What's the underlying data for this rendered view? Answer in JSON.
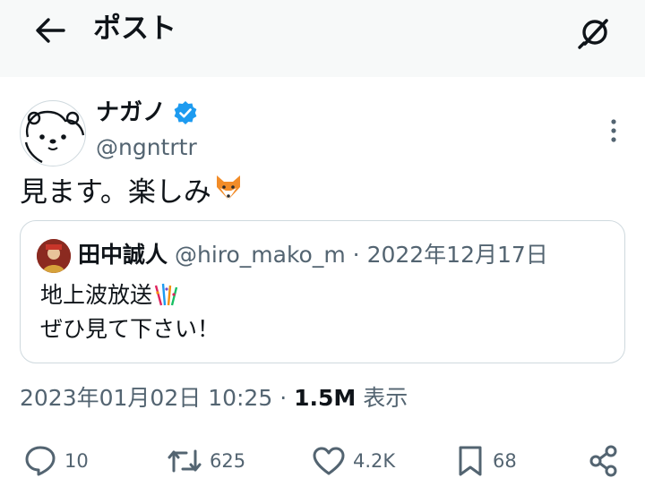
{
  "header": {
    "title": "ポスト",
    "back_icon": "arrow-left-icon",
    "grok_icon": "grok-icon"
  },
  "author": {
    "name": "ナガノ",
    "handle": "@ngntrtr",
    "verified": true,
    "verified_color": "#1d9bf0"
  },
  "tweet": {
    "text": "見ます。楽しみ",
    "emoji": "🦊"
  },
  "quote": {
    "name": "田中誠人",
    "handle": "@hiro_mako_m",
    "separator": "·",
    "date": "2022年12月17日",
    "line1": "地上波放送",
    "line1_emoji": "🎊",
    "line2": "ぜひ見て下さい！"
  },
  "meta": {
    "timestamp": "2023年01月02日 10:25",
    "separator": "·",
    "views_count": "1.5M",
    "views_label": "表示"
  },
  "actions": {
    "replies": "10",
    "reposts": "625",
    "likes": "4.2K",
    "bookmarks": "68"
  },
  "colors": {
    "header_bg": "#f7f9f9",
    "text": "#0f1419",
    "secondary": "#536471",
    "border": "#cfd9de",
    "accent": "#1d9bf0"
  }
}
